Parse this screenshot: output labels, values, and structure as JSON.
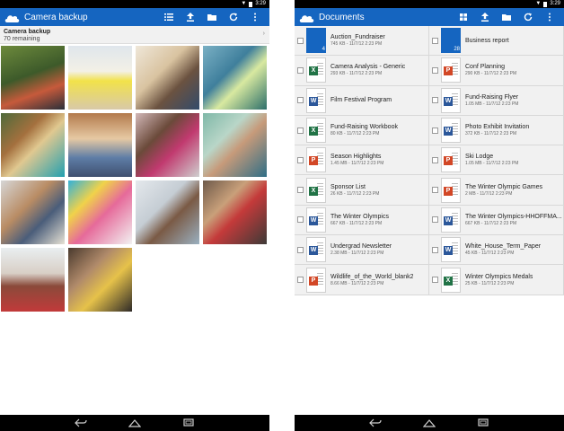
{
  "colors": {
    "appbar": "#1565c0",
    "word": "#2b579a",
    "excel": "#217346",
    "powerpoint": "#d24726",
    "folder": "#1565c0"
  },
  "left": {
    "status_time": "3:29",
    "title": "Camera backup",
    "subheader": {
      "title": "Camera backup",
      "count": "70 remaining"
    },
    "actions": [
      "list-view-icon",
      "upload-icon",
      "new-folder-icon",
      "refresh-icon",
      "more-icon"
    ],
    "photos": [
      "men-by-mural-photo",
      "woman-jumping-beach-photo",
      "couple-with-laptop-photo",
      "woman-with-tablet-photo",
      "couple-standing-photo",
      "man-smiling-photo",
      "woman-with-tablet-sofa-photo",
      "man-with-phone-photo",
      "woman-smiling-photo",
      "girl-with-colorful-papers-photo",
      "man-at-desk-photo",
      "woman-with-book-photo",
      "woman-walking-photo",
      "family-with-child-photo"
    ]
  },
  "right": {
    "status_time": "3:29",
    "title": "Documents",
    "actions": [
      "grid-view-icon",
      "upload-icon",
      "new-folder-icon",
      "refresh-icon",
      "more-icon"
    ],
    "documents": [
      {
        "name": "Auction_Fundraiser",
        "meta": "745 KB - 11/7/12 2:23 PM",
        "type": "folder",
        "count": "4"
      },
      {
        "name": "Business report",
        "meta": "",
        "type": "folder",
        "count": "28"
      },
      {
        "name": "Camera Analysis - Generic",
        "meta": "293 KB - 11/7/12 2:23 PM",
        "type": "excel",
        "count": ""
      },
      {
        "name": "Conf Planning",
        "meta": "290 KB - 11/7/12 2:23 PM",
        "type": "powerpoint",
        "count": ""
      },
      {
        "name": "Film Festival Program",
        "meta": "",
        "type": "word",
        "count": ""
      },
      {
        "name": "Fund-Raising Flyer",
        "meta": "1.05 MB - 11/7/12 2:23 PM",
        "type": "word",
        "count": ""
      },
      {
        "name": "Fund-Raising Workbook",
        "meta": "80 KB - 11/7/12 2:23 PM",
        "type": "excel",
        "count": ""
      },
      {
        "name": "Photo Exhibit Invitation",
        "meta": "372 KB - 11/7/12 2:23 PM",
        "type": "word",
        "count": ""
      },
      {
        "name": "Season Highlights",
        "meta": "1.45 MB - 11/7/12 2:23 PM",
        "type": "powerpoint",
        "count": ""
      },
      {
        "name": "Ski Lodge",
        "meta": "1.05 MB - 11/7/12 2:23 PM",
        "type": "powerpoint",
        "count": ""
      },
      {
        "name": "Sponsor List",
        "meta": "26 KB - 11/7/12 2:23 PM",
        "type": "excel",
        "count": ""
      },
      {
        "name": "The Winter Olympic Games",
        "meta": "2 MB - 11/7/12 2:23 PM",
        "type": "powerpoint",
        "count": ""
      },
      {
        "name": "The Winter Olympics",
        "meta": "667 KB - 11/7/12 2:23 PM",
        "type": "word",
        "count": ""
      },
      {
        "name": "The Winter Olympics-HHOFFMA...",
        "meta": "667 KB - 11/7/12 2:23 PM",
        "type": "word",
        "count": ""
      },
      {
        "name": "Undergrad Newsletter",
        "meta": "2.38 MB - 11/7/12 2:23 PM",
        "type": "word",
        "count": ""
      },
      {
        "name": "White_House_Term_Paper",
        "meta": "45 KB - 11/7/12 2:23 PM",
        "type": "word",
        "count": ""
      },
      {
        "name": "Wildlife_of_the_World_blank2",
        "meta": "8.66 MB - 11/7/12 2:23 PM",
        "type": "powerpoint",
        "count": ""
      },
      {
        "name": "Winter Olympics Medals",
        "meta": "25 KB - 11/7/12 2:23 PM",
        "type": "excel",
        "count": ""
      }
    ]
  }
}
